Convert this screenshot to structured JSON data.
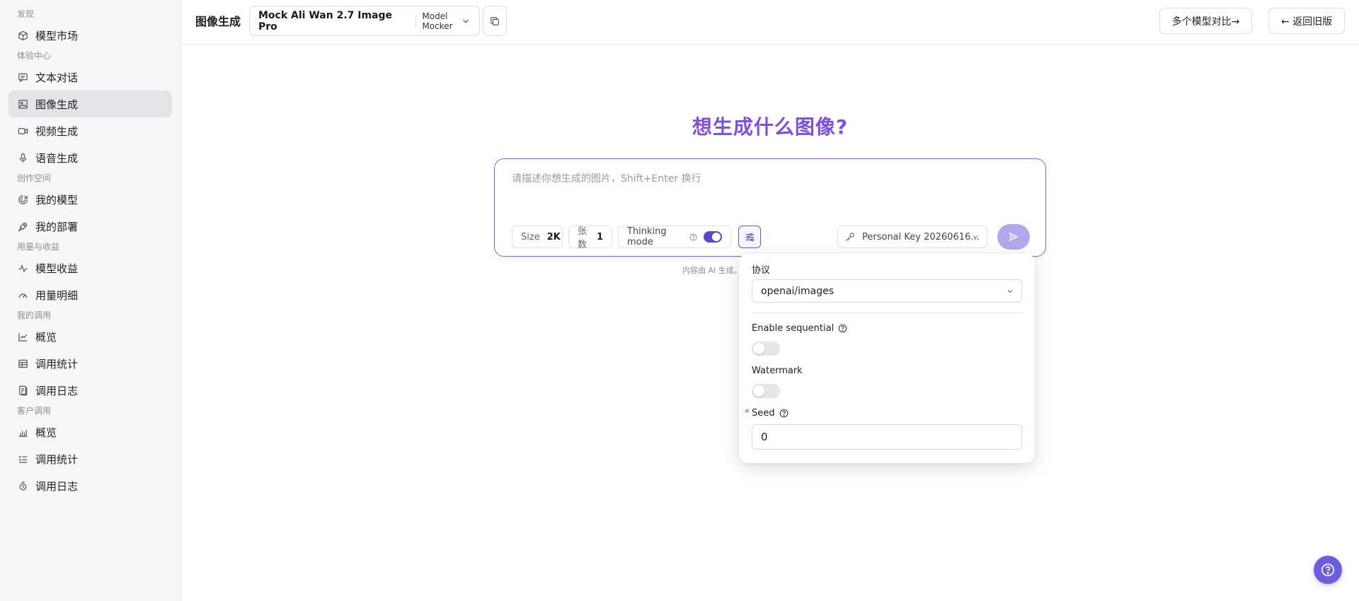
{
  "sidebar": {
    "sections": [
      {
        "title": "发现",
        "items": [
          {
            "label": "模型市场",
            "icon": "box-icon"
          }
        ]
      },
      {
        "title": "体验中心",
        "items": [
          {
            "label": "文本对话",
            "icon": "chat-icon"
          },
          {
            "label": "图像生成",
            "icon": "image-icon",
            "active": true
          },
          {
            "label": "视频生成",
            "icon": "video-icon"
          },
          {
            "label": "语音生成",
            "icon": "mic-icon"
          }
        ]
      },
      {
        "title": "创作空间",
        "items": [
          {
            "label": "我的模型",
            "icon": "model-icon"
          },
          {
            "label": "我的部署",
            "icon": "rocket-icon"
          }
        ]
      },
      {
        "title": "用量与收益",
        "items": [
          {
            "label": "模型收益",
            "icon": "activity-icon"
          },
          {
            "label": "用量明细",
            "icon": "gauge-icon"
          }
        ]
      },
      {
        "title": "我的调用",
        "items": [
          {
            "label": "概览",
            "icon": "line-chart-icon"
          },
          {
            "label": "调用统计",
            "icon": "table-icon"
          },
          {
            "label": "调用日志",
            "icon": "log-icon"
          }
        ]
      },
      {
        "title": "客户调用",
        "items": [
          {
            "label": "概览",
            "icon": "bar-chart-icon"
          },
          {
            "label": "调用统计",
            "icon": "list-check-icon"
          },
          {
            "label": "调用日志",
            "icon": "log-alt-icon"
          }
        ]
      }
    ]
  },
  "header": {
    "title": "图像生成",
    "model_name": "Mock Ali Wan 2.7 Image Pro",
    "model_provider": "Model Mocker",
    "compare_label": "多个模型对比→",
    "back_label": "← 返回旧版"
  },
  "main": {
    "hero": "想生成什么图像?",
    "prompt_placeholder": "请描述你想生成的图片，Shift+Enter 换行",
    "size_label": "Size",
    "size_value": "2K",
    "count_label": "张数",
    "count_value": "1",
    "thinking_label": "Thinking mode",
    "thinking_enabled": true,
    "key_label": "Personal Key 20260616...",
    "disclaimer": "内容由 AI 生成，"
  },
  "popover": {
    "protocol_label": "协议",
    "protocol_value": "openai/images",
    "sequential_label": "Enable sequential",
    "sequential_enabled": false,
    "watermark_label": "Watermark",
    "watermark_enabled": false,
    "seed_label": "Seed",
    "seed_value": "0"
  },
  "colors": {
    "accent": "#5847c9",
    "hero": "#7e4fe3",
    "send": "#b3a7ed"
  }
}
